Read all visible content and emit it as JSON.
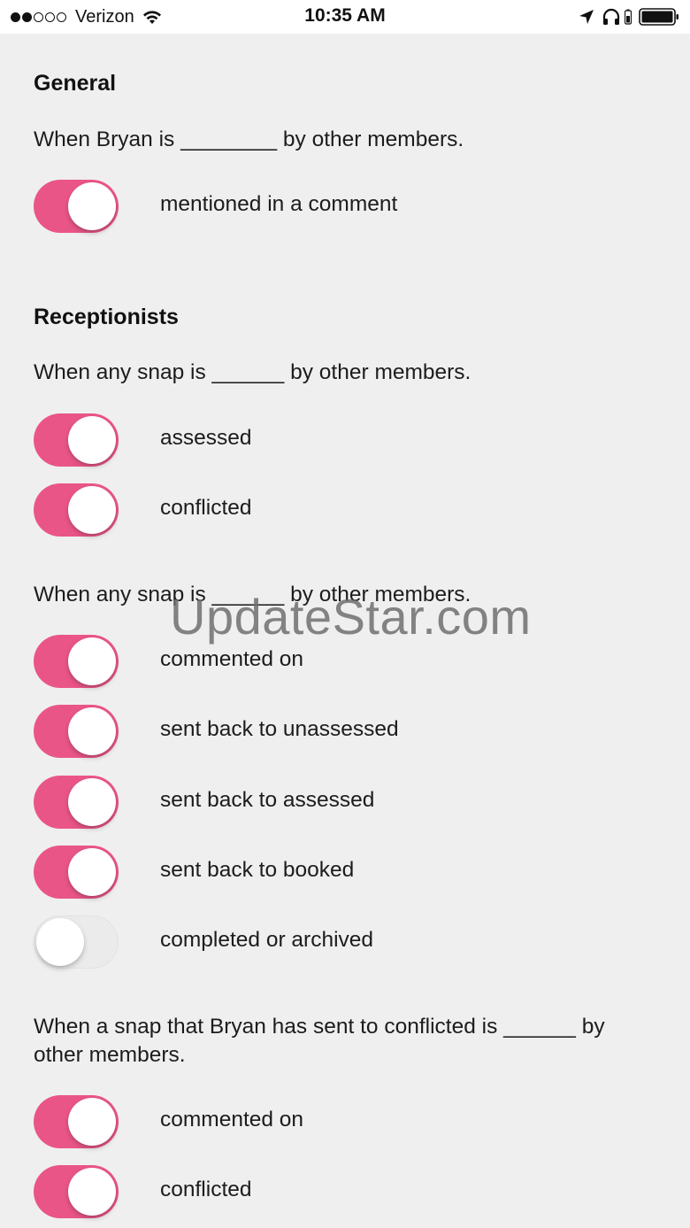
{
  "status_bar": {
    "signal_dots_filled": 2,
    "signal_dots_total": 5,
    "carrier": "Verizon",
    "time": "10:35 AM",
    "icons": [
      "wifi-icon",
      "location-arrow-icon",
      "headphones-icon",
      "bluetooth-battery-icon",
      "battery-icon"
    ]
  },
  "sections": [
    {
      "title": "General",
      "groups": [
        {
          "prompt": "When Bryan is ________ by other members.",
          "toggles": [
            {
              "label": "mentioned in a comment",
              "on": true
            }
          ]
        }
      ]
    },
    {
      "title": "Receptionists",
      "groups": [
        {
          "prompt": "When any snap is ______ by other members.",
          "toggles": [
            {
              "label": "assessed",
              "on": true
            },
            {
              "label": "conflicted",
              "on": true
            }
          ]
        },
        {
          "prompt": "When any snap is ______ by other members.",
          "toggles": [
            {
              "label": "commented on",
              "on": true
            },
            {
              "label": "sent back to unassessed",
              "on": true
            },
            {
              "label": "sent back to assessed",
              "on": true
            },
            {
              "label": "sent back to booked",
              "on": true
            },
            {
              "label": "completed or archived",
              "on": false
            }
          ]
        },
        {
          "prompt": "When a snap that Bryan has sent to conflicted is ______ by other members.",
          "toggles": [
            {
              "label": "commented on",
              "on": true
            },
            {
              "label": "conflicted",
              "on": true
            }
          ]
        }
      ]
    }
  ],
  "watermark": "UpdateStar.com",
  "colors": {
    "toggle_on": "#ea5588",
    "toggle_off": "#ebebeb",
    "background": "#efefef"
  }
}
